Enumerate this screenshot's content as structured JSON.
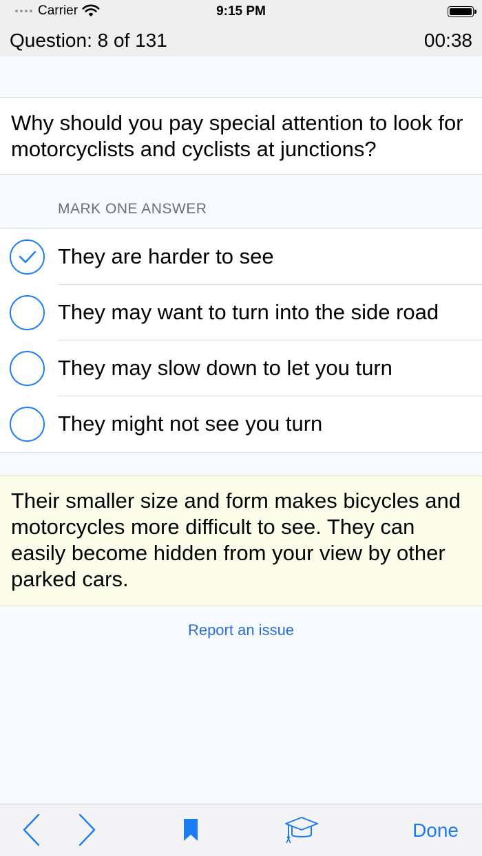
{
  "status_bar": {
    "carrier": "Carrier",
    "time": "9:15 PM"
  },
  "quiz_header": {
    "question_counter": "Question: 8 of 131",
    "timer": "00:38"
  },
  "question": {
    "text": "Why should you pay special attention to look for motorcyclists and cyclists at junctions?"
  },
  "answers_section": {
    "header": "MARK ONE ANSWER",
    "options": [
      {
        "label": "They are harder to see",
        "selected": true
      },
      {
        "label": "They may want to turn into the side road",
        "selected": false
      },
      {
        "label": "They may slow down to let you turn",
        "selected": false
      },
      {
        "label": "They might not see you turn",
        "selected": false
      }
    ]
  },
  "explanation": {
    "text": "Their smaller size and form makes bicycles and motorcycles more difficult to see. They can easily become hidden from your view by other parked cars."
  },
  "report_link": "Report an issue",
  "toolbar": {
    "done_label": "Done",
    "icons": [
      "chevron-left-icon",
      "chevron-right-icon",
      "bookmark-icon",
      "graduation-cap-icon"
    ]
  },
  "colors": {
    "accent": "#1a7df7",
    "link": "#2a6ed8",
    "explanation_bg": "#fbfde9",
    "page_bg": "#f7fbff"
  }
}
